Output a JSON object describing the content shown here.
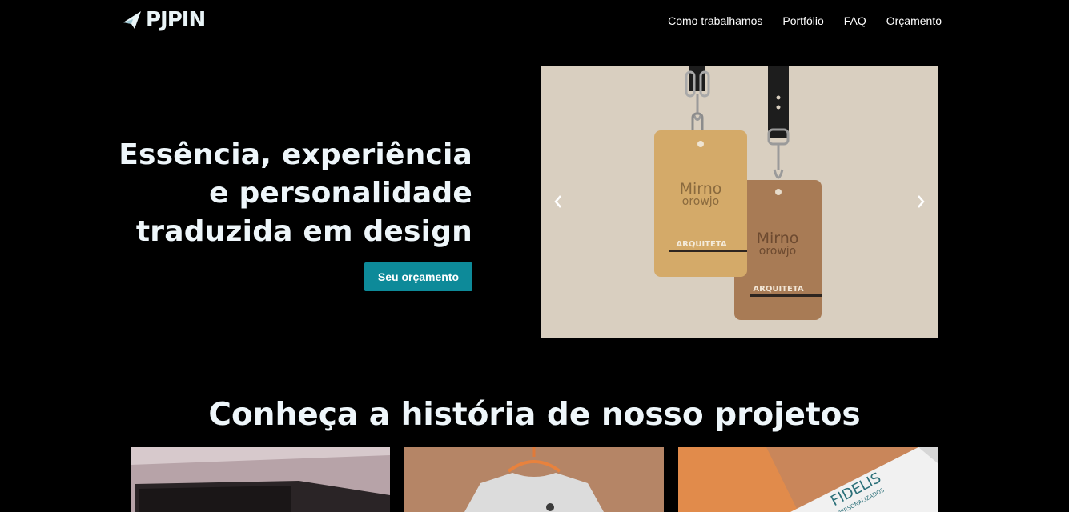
{
  "brand": {
    "name": "PJPIN"
  },
  "nav": {
    "items": [
      {
        "label": "Como trabalhamos"
      },
      {
        "label": "Portfólio"
      },
      {
        "label": "FAQ"
      },
      {
        "label": "Orçamento"
      }
    ]
  },
  "hero": {
    "lines": [
      "Essência, experiência",
      "e personalidade",
      "traduzida em design"
    ],
    "cta_label": "Seu orçamento"
  },
  "carousel": {
    "tag_brand_top": "Mirno",
    "tag_brand_bottom": "orowjo",
    "tag_subtitle": "ARQUITETA",
    "prev_icon": "chevron-left-icon",
    "next_icon": "chevron-right-icon"
  },
  "projects": {
    "title": "Conheça a história de nosso projetos",
    "card3_brand": "FIDELIS",
    "card3_sub": "PERSONALIZADOS"
  },
  "colors": {
    "accent": "#0d8a99",
    "background": "#000000",
    "heading": "#eef6fa",
    "carousel_bg": "#d9cfc0"
  }
}
